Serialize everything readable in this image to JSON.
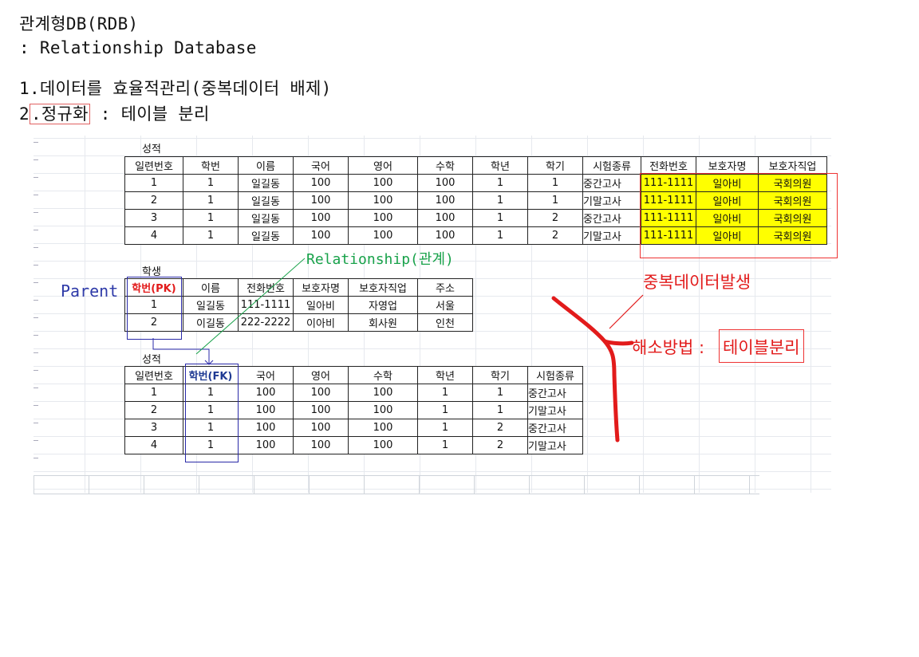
{
  "title": {
    "line1": "관계형DB(RDB)",
    "line2": ": Relationship Database",
    "line3": "1.데이터를 효율적관리(중복데이터 배제)",
    "line4_prefix": "2",
    "line4_boxed": ".정규화",
    "line4_rest": " : 테이블 분리"
  },
  "grade_table": {
    "caption": "성적",
    "headers": [
      "일련번호",
      "학번",
      "이름",
      "국어",
      "영어",
      "수학",
      "학년",
      "학기",
      "시험종류",
      "전화번호",
      "보호자명",
      "보호자직업"
    ],
    "rows": [
      [
        "1",
        "1",
        "일길동",
        "100",
        "100",
        "100",
        "1",
        "1",
        "중간고사",
        "111-1111",
        "일아비",
        "국회의원"
      ],
      [
        "2",
        "1",
        "일길동",
        "100",
        "100",
        "100",
        "1",
        "1",
        "기말고사",
        "111-1111",
        "일아비",
        "국회의원"
      ],
      [
        "3",
        "1",
        "일길동",
        "100",
        "100",
        "100",
        "1",
        "2",
        "중간고사",
        "111-1111",
        "일아비",
        "국회의원"
      ],
      [
        "4",
        "1",
        "일길동",
        "100",
        "100",
        "100",
        "1",
        "2",
        "기말고사",
        "111-1111",
        "일아비",
        "국회의원"
      ]
    ],
    "highlight_color": "#ffff00"
  },
  "student_table": {
    "caption": "학생",
    "headers": [
      "학번(PK)",
      "이름",
      "전화번호",
      "보호자명",
      "보호자직업",
      "주소"
    ],
    "rows": [
      [
        "1",
        "일길동",
        "111-1111",
        "일아비",
        "자영업",
        "서울"
      ],
      [
        "2",
        "이길동",
        "222-2222",
        "이아비",
        "회사원",
        "인천"
      ]
    ]
  },
  "grade_table2": {
    "caption": "성적",
    "headers": [
      "일련번호",
      "학번(FK)",
      "국어",
      "영어",
      "수학",
      "학년",
      "학기",
      "시험종류"
    ],
    "rows": [
      [
        "1",
        "1",
        "100",
        "100",
        "100",
        "1",
        "1",
        "중간고사"
      ],
      [
        "2",
        "1",
        "100",
        "100",
        "100",
        "1",
        "1",
        "기말고사"
      ],
      [
        "3",
        "1",
        "100",
        "100",
        "100",
        "1",
        "2",
        "중간고사"
      ],
      [
        "4",
        "1",
        "100",
        "100",
        "100",
        "1",
        "2",
        "기말고사"
      ]
    ]
  },
  "annotations": {
    "parent": "Parent",
    "relationship": "Relationship(관계)",
    "duplicate": "중복데이터발생",
    "solution_label": "해소방법 :",
    "solution_boxed": "테이블분리"
  },
  "colors": {
    "accent_red": "#e21b1b",
    "parent_blue": "#2e3aa8",
    "relationship_green": "#18a24a"
  }
}
